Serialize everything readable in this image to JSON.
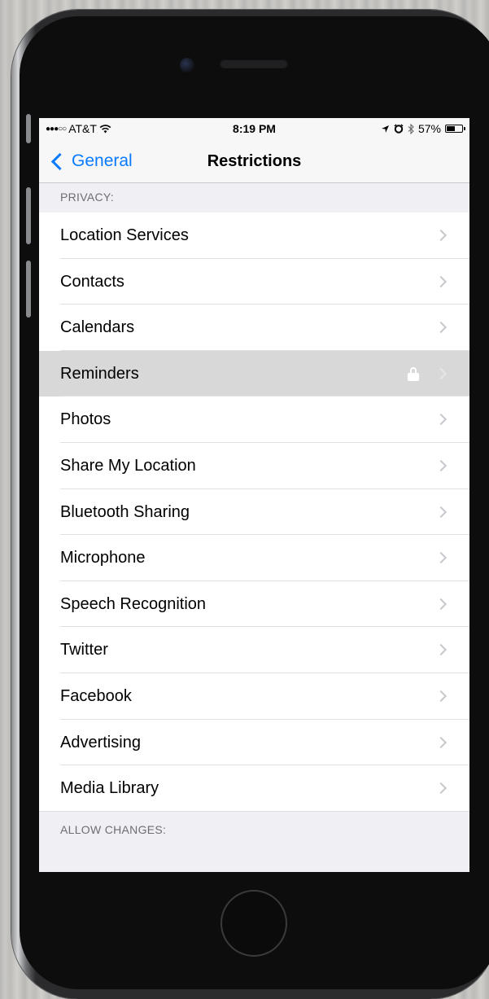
{
  "status_bar": {
    "carrier": "AT&T",
    "time": "8:19 PM",
    "battery": "57%",
    "battery_level": 0.57,
    "icons": [
      "signal-icon",
      "wifi-icon",
      "location-arrow-icon",
      "alarm-icon",
      "bluetooth-icon",
      "battery-icon"
    ]
  },
  "nav": {
    "back_label": "General",
    "title": "Restrictions"
  },
  "sections": {
    "privacy_header": "PRIVACY:",
    "allow_changes_header": "ALLOW CHANGES:"
  },
  "privacy_items": [
    {
      "label": "Location Services"
    },
    {
      "label": "Contacts"
    },
    {
      "label": "Calendars"
    },
    {
      "label": "Reminders",
      "highlighted": true,
      "locked": true
    },
    {
      "label": "Photos"
    },
    {
      "label": "Share My Location"
    },
    {
      "label": "Bluetooth Sharing"
    },
    {
      "label": "Microphone"
    },
    {
      "label": "Speech Recognition"
    },
    {
      "label": "Twitter"
    },
    {
      "label": "Facebook"
    },
    {
      "label": "Advertising"
    },
    {
      "label": "Media Library"
    }
  ],
  "colors": {
    "accent": "#0a7aff",
    "group_background": "#efeff4",
    "highlight_row": "#d8d8d8"
  }
}
